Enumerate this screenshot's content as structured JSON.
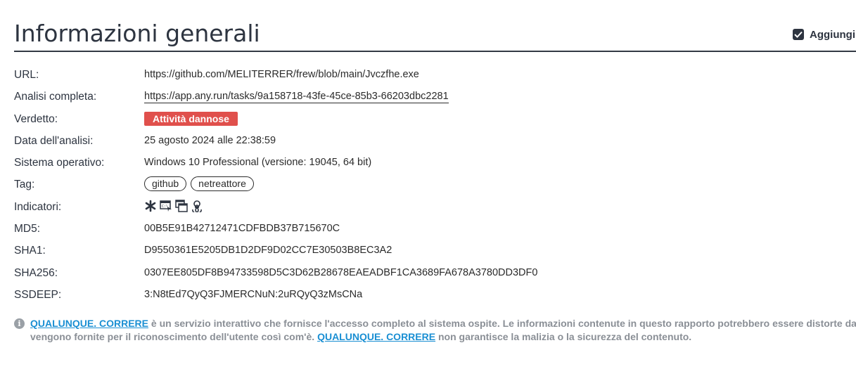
{
  "header": {
    "title": "Informazioni generali",
    "add_label": "Aggiungi p"
  },
  "rows": {
    "url": {
      "label": "URL:",
      "value": "https://github.com/MELITERRER/frew/blob/main/Jvczfhe.exe"
    },
    "analysis": {
      "label": "Analisi completa:",
      "value": "https://app.any.run/tasks/9a158718-43fe-45ce-85b3-66203dbc2281"
    },
    "verdict": {
      "label": "Verdetto:",
      "value": "Attività dannose",
      "color": "#e0504c"
    },
    "date": {
      "label": "Data dell'analisi:",
      "value": "25 agosto 2024 alle 22:38:59"
    },
    "os": {
      "label": "Sistema operativo:",
      "value": "Windows 10 Professional (versione: 19045, 64 bit)"
    },
    "tags": {
      "label": "Tag:",
      "items": [
        "github",
        "netreattore"
      ]
    },
    "indicators": {
      "label": "Indicatori:",
      "icons": [
        "asterisk-icon",
        "cmd-icon",
        "windows-icon",
        "biohazard-icon"
      ]
    },
    "md5": {
      "label": "MD5:",
      "value": "00B5E91B42712471CDFBDB37B715670C"
    },
    "sha1": {
      "label": "SHA1:",
      "value": "D9550361E5205DB1D2DF9D02CC7E30503B8EC3A2"
    },
    "sha256": {
      "label": "SHA256:",
      "value": "0307EE805DF8B94733598D5C3D62B28678EAEADBF1CA3689FA678A3780DD3DF0"
    },
    "ssdeep": {
      "label": "SSDEEP:",
      "value": "3:N8tEd7QyQ3FJMERCNuN:2uRQyQ3zMsCNa"
    }
  },
  "notice": {
    "link1": "QUALUNQUE. CORRERE",
    "text1": " è un servizio interattivo che fornisce l'accesso completo al sistema ospite. Le informazioni contenute in questo rapporto potrebbero essere distorte dal",
    "text2": "vengono fornite per il riconoscimento dell'utente così com'è. ",
    "link2": "QUALUNQUE. CORRERE",
    "text3": " non garantisce la malizia o la sicurezza del contenuto."
  }
}
